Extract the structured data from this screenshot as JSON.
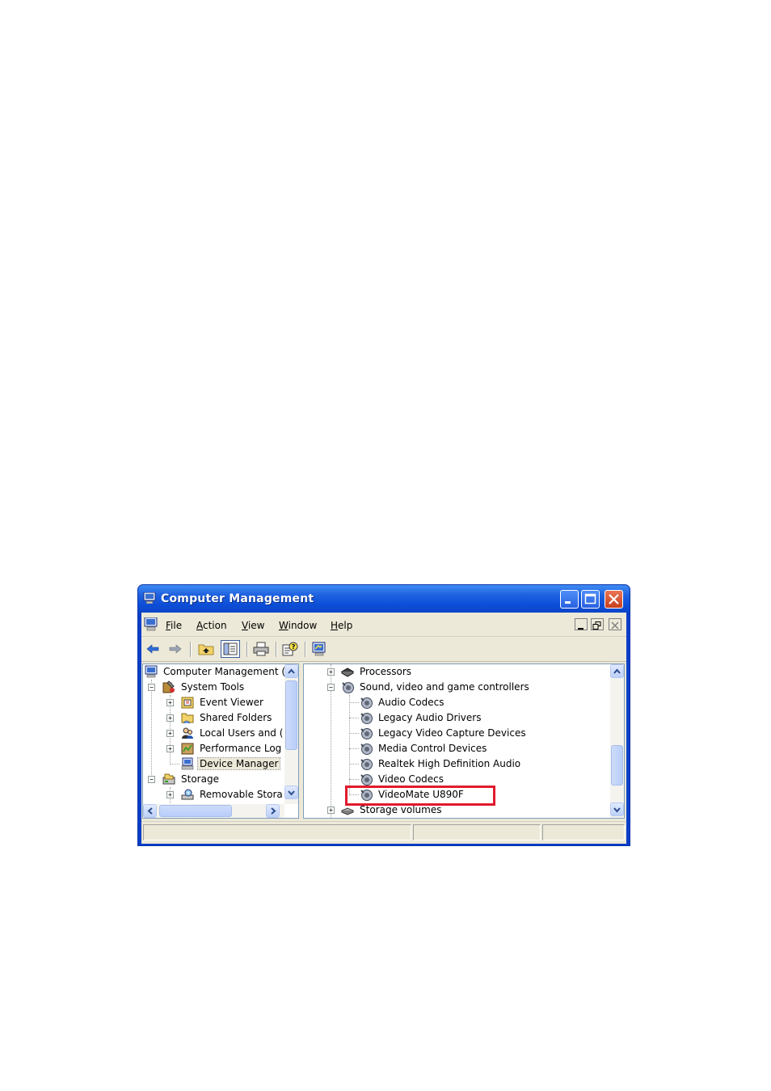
{
  "window": {
    "title": "Computer Management"
  },
  "menu": {
    "file": "File",
    "action": "Action",
    "view": "View",
    "window": "Window",
    "help": "Help"
  },
  "toolbar": {
    "icons": [
      "back-icon",
      "forward-icon",
      "up-folder-icon",
      "show-hide-tree-icon",
      "print-icon",
      "help-icon",
      "properties-icon"
    ]
  },
  "left_tree": {
    "items": [
      {
        "label": "Computer Management (",
        "expander": ""
      },
      {
        "label": "System Tools",
        "expander": "−"
      },
      {
        "label": "Event Viewer",
        "expander": "+"
      },
      {
        "label": "Shared Folders",
        "expander": "+"
      },
      {
        "label": "Local Users and (",
        "expander": "+"
      },
      {
        "label": "Performance Log",
        "expander": "+"
      },
      {
        "label": "Device Manager",
        "expander": ""
      },
      {
        "label": "Storage",
        "expander": "−"
      },
      {
        "label": "Removable Stora",
        "expander": "+"
      }
    ]
  },
  "right_tree": {
    "items": [
      {
        "label": "Processors",
        "expander": "+"
      },
      {
        "label": "Sound, video and game controllers",
        "expander": "−"
      },
      {
        "label": "Audio Codecs"
      },
      {
        "label": "Legacy Audio Drivers"
      },
      {
        "label": "Legacy Video Capture Devices"
      },
      {
        "label": "Media Control Devices"
      },
      {
        "label": "Realtek High Definition Audio"
      },
      {
        "label": "Video Codecs"
      },
      {
        "label": "VideoMate U890F"
      },
      {
        "label": "Storage volumes",
        "expander": "+"
      }
    ]
  },
  "colors": {
    "highlight_box": "#e21a2c",
    "titlebar": "#0d4fd8"
  }
}
